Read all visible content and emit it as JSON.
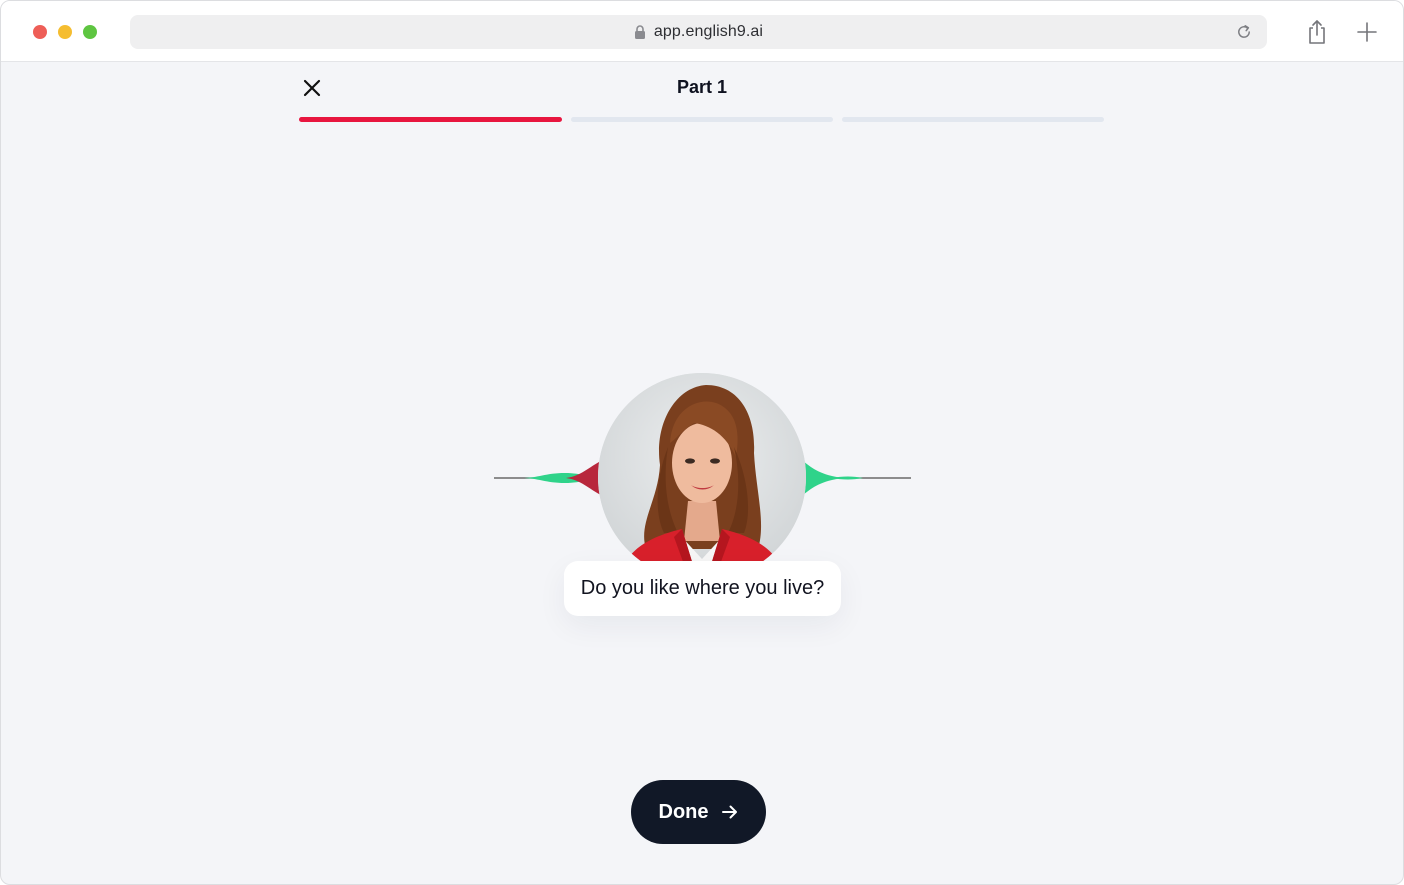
{
  "browser": {
    "url": "app.english9.ai",
    "icons": {
      "lock": "lock-icon",
      "reload": "reload-icon",
      "share": "share-icon",
      "new_tab": "plus-icon"
    }
  },
  "header": {
    "title": "Part 1",
    "close_icon": "close-icon",
    "progress": [
      {
        "state": "active",
        "fill": 1.0
      },
      {
        "state": "inactive",
        "fill": 0.0
      },
      {
        "state": "inactive",
        "fill": 0.0
      }
    ]
  },
  "speaker": {
    "question": "Do you like where you live?",
    "avatar": "examiner-portrait"
  },
  "actions": {
    "done_label": "Done",
    "done_icon": "arrow-right-icon"
  },
  "colors": {
    "accent_red": "#e8163f",
    "wave_green": "#2fd38a",
    "wave_red": "#b8273c",
    "button_dark": "#111827",
    "background": "#f4f5f8"
  }
}
